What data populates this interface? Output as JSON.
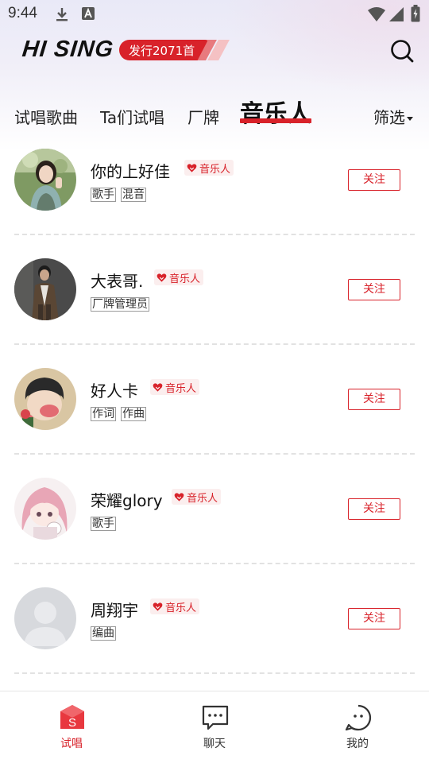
{
  "status_bar": {
    "time": "9:44"
  },
  "header": {
    "brand": "HI SING",
    "release_badge": "发行2071首",
    "search_icon": "search-icon"
  },
  "tabs": [
    {
      "label": "试唱歌曲",
      "active": false
    },
    {
      "label": "Ta们试唱",
      "active": false
    },
    {
      "label": "厂牌",
      "active": false
    },
    {
      "label": "音乐人",
      "active": true
    }
  ],
  "filter_label": "筛选",
  "accent_color": "#d8222a",
  "artists": [
    {
      "name": "你的上好佳",
      "badge": "音乐人",
      "tags": [
        "歌手",
        "混音"
      ],
      "follow_label": "关注"
    },
    {
      "name": "大表哥.",
      "badge": "音乐人",
      "tags": [
        "厂牌管理员"
      ],
      "follow_label": "关注"
    },
    {
      "name": "好人卡",
      "badge": "音乐人",
      "tags": [
        "作词",
        "作曲"
      ],
      "follow_label": "关注"
    },
    {
      "name": "荣耀glory",
      "badge": "音乐人",
      "tags": [
        "歌手"
      ],
      "follow_label": "关注"
    },
    {
      "name": "周翔宇",
      "badge": "音乐人",
      "tags": [
        "编曲"
      ],
      "follow_label": "关注"
    }
  ],
  "bottom_nav": [
    {
      "label": "试唱",
      "icon": "sing-icon",
      "active": true
    },
    {
      "label": "聊天",
      "icon": "chat-icon",
      "active": false
    },
    {
      "label": "我的",
      "icon": "profile-icon",
      "active": false
    }
  ]
}
